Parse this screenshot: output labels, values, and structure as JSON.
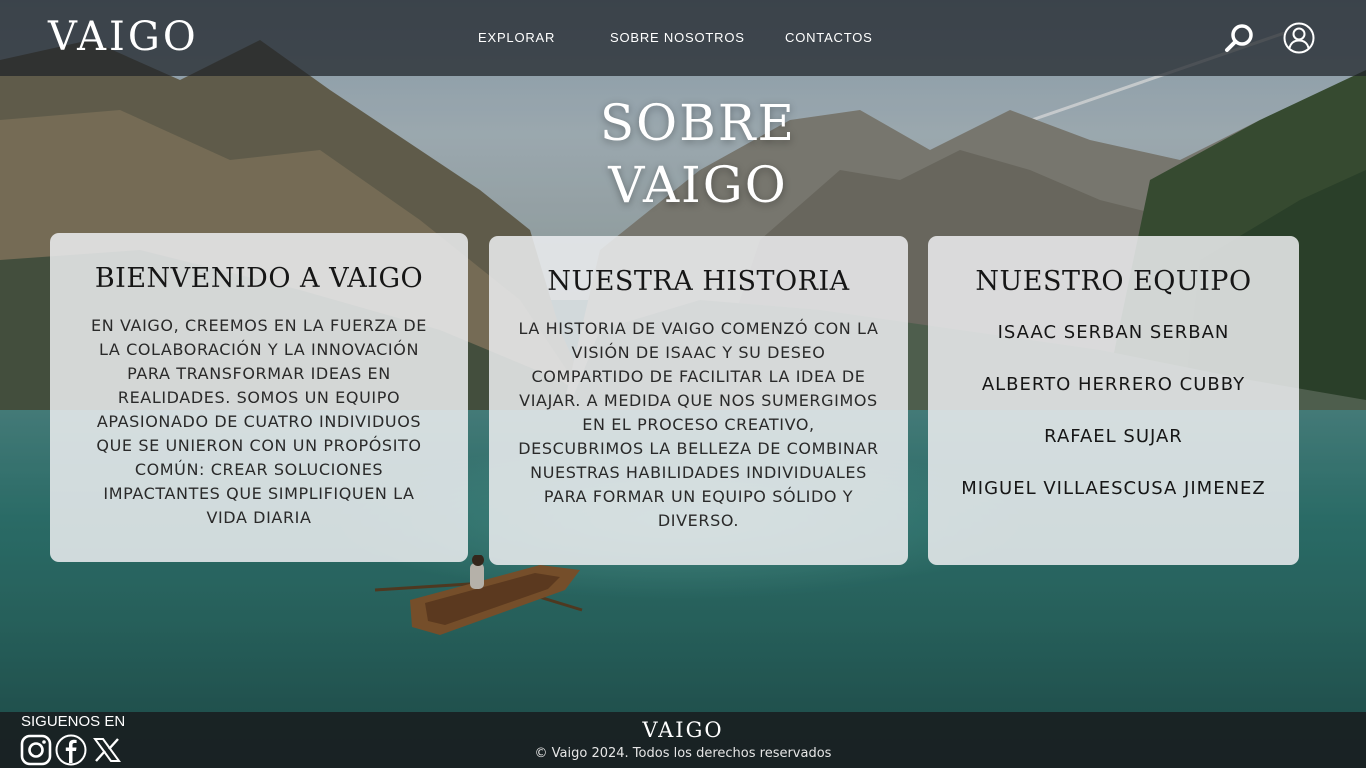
{
  "header": {
    "logo": "VAIGO",
    "nav": [
      {
        "label": "EXPLORAR"
      },
      {
        "label": "SOBRE NOSOTROS"
      },
      {
        "label": "CONTACTOS"
      }
    ],
    "icons": {
      "search": "search-icon",
      "account": "user-icon"
    }
  },
  "hero": {
    "title_line1": "SOBRE",
    "title_line2": "VAIGO"
  },
  "cards": {
    "bienvenido": {
      "title": "BIENVENIDO A VAIGO",
      "body": "EN VAIGO, CREEMOS EN LA FUERZA DE LA COLABORACIÓN Y LA INNOVACIÓN PARA TRANSFORMAR IDEAS EN REALIDADES. SOMOS UN EQUIPO APASIONADO DE CUATRO INDIVIDUOS QUE SE UNIERON CON UN PROPÓSITO COMÚN: CREAR SOLUCIONES IMPACTANTES QUE SIMPLIFIQUEN LA VIDA DIARIA"
    },
    "historia": {
      "title": "NUESTRA HISTORIA",
      "body": "LA HISTORIA DE VAIGO COMENZÓ CON LA VISIÓN DE ISAAC Y SU DESEO COMPARTIDO DE FACILITAR LA IDEA DE VIAJAR. A MEDIDA QUE NOS SUMERGIMOS EN EL PROCESO CREATIVO, DESCUBRIMOS LA BELLEZA DE COMBINAR NUESTRAS HABILIDADES INDIVIDUALES PARA FORMAR UN EQUIPO SÓLIDO Y DIVERSO."
    },
    "equipo": {
      "title": "NUESTRO EQUIPO",
      "members": [
        "ISAAC SERBAN SERBAN",
        "ALBERTO HERRERO CUBBY",
        "RAFAEL SUJAR",
        "MIGUEL VILLAESCUSA JIMENEZ"
      ]
    }
  },
  "footer": {
    "follow_label": "SIGUENOS EN",
    "social_icons": [
      "instagram-icon",
      "facebook-icon",
      "x-icon"
    ],
    "logo": "VAIGO",
    "copyright": "© Vaigo 2024. Todos los derechos reservados"
  },
  "colors": {
    "header_bg": "#1e2228",
    "card_bg": "#eceef0",
    "text_dark": "#161616",
    "text_light": "#ffffff"
  }
}
